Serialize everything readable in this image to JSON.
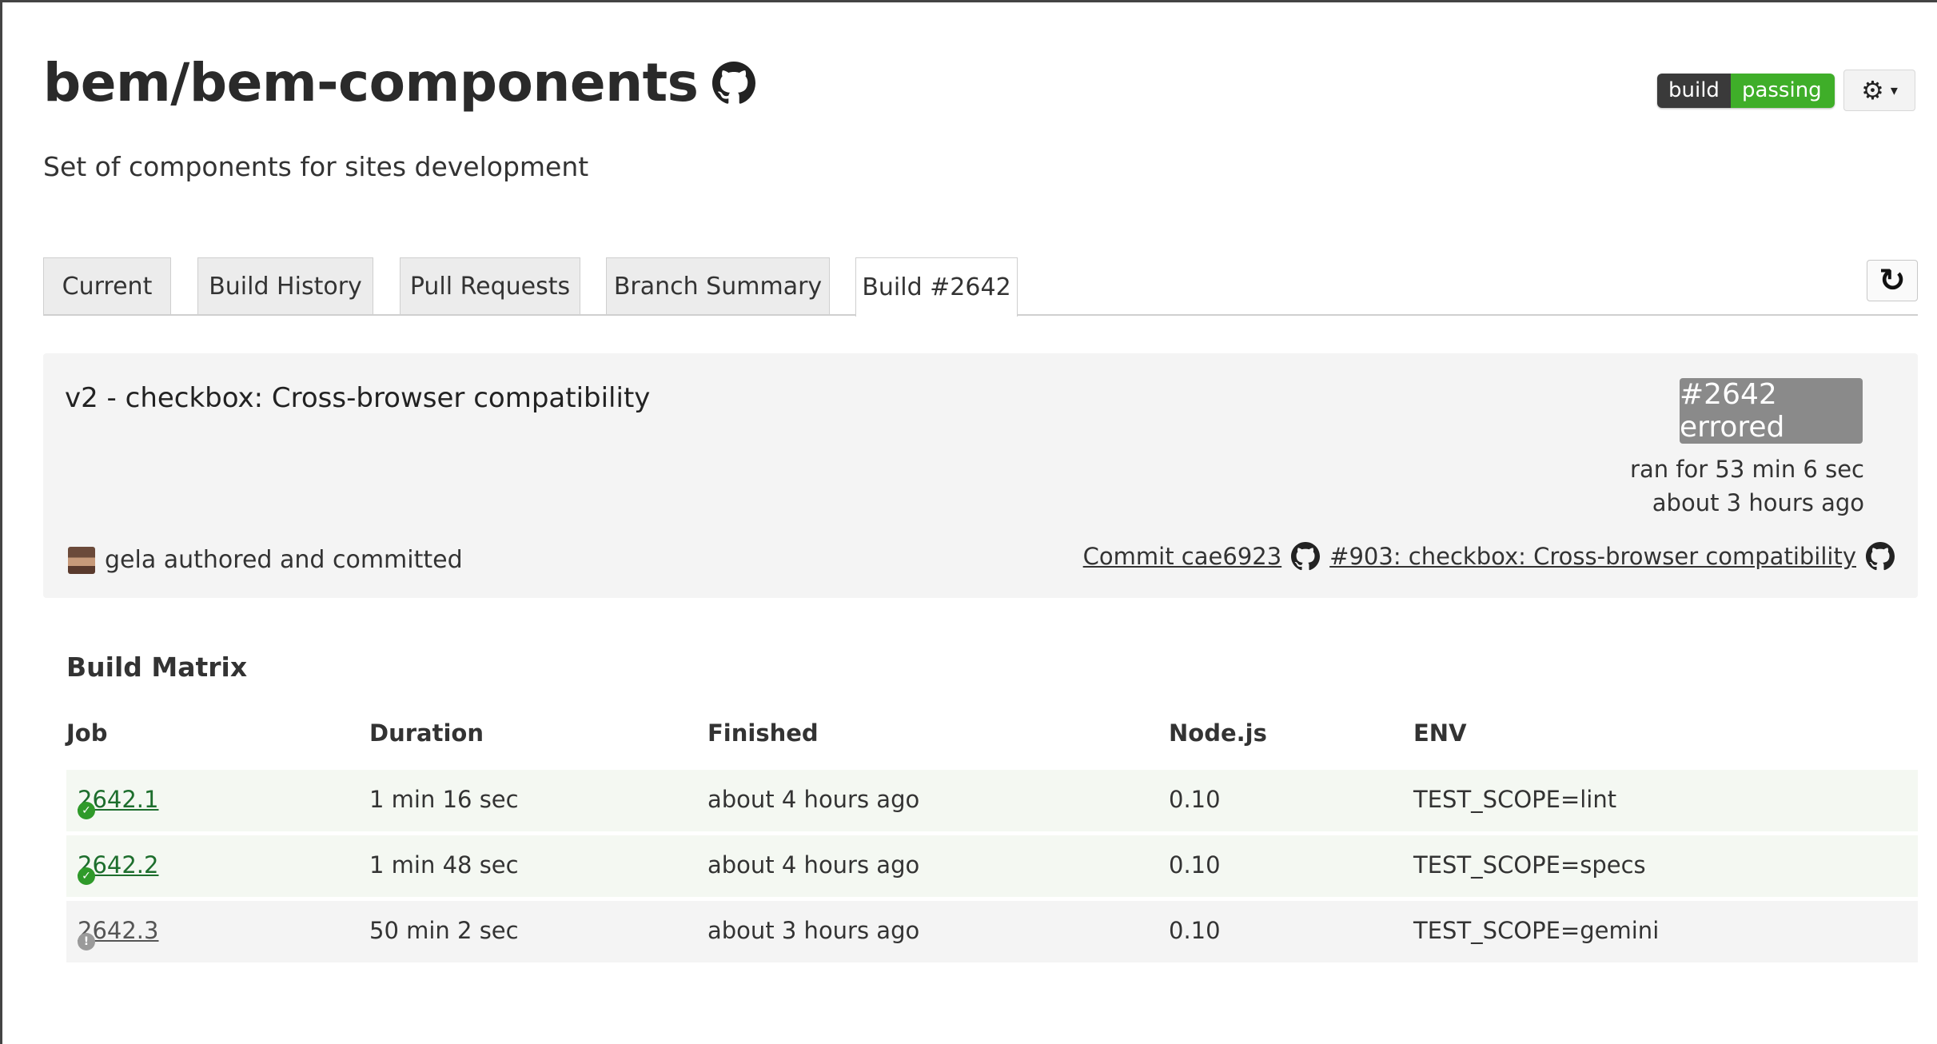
{
  "header": {
    "repo": "bem/bem-components",
    "description": "Set of components for sites development",
    "badge_left": "build",
    "badge_right": "passing",
    "gear_caret": "▾"
  },
  "tabs": [
    {
      "label": "Current"
    },
    {
      "label": "Build History"
    },
    {
      "label": "Pull Requests"
    },
    {
      "label": "Branch Summary"
    },
    {
      "label": "Build #2642",
      "active": true
    }
  ],
  "build": {
    "commit_message": "v2 - checkbox: Cross-browser compatibility",
    "status": "#2642 errored",
    "ran_for": "ran for 53 min 6 sec",
    "finished_ago": "about 3 hours ago",
    "author": "gela authored and committed",
    "commit_link": "Commit cae6923",
    "pr_link": "#903: checkbox: Cross-browser compatibility"
  },
  "matrix": {
    "title": "Build Matrix",
    "columns": {
      "job": "Job",
      "duration": "Duration",
      "finished": "Finished",
      "node": "Node.js",
      "env": "ENV"
    },
    "rows": [
      {
        "state": "passed",
        "job": "2642.1",
        "duration": "1 min 16 sec",
        "finished": "about 4 hours ago",
        "node": "0.10",
        "env": "TEST_SCOPE=lint"
      },
      {
        "state": "passed",
        "job": "2642.2",
        "duration": "1 min 48 sec",
        "finished": "about 4 hours ago",
        "node": "0.10",
        "env": "TEST_SCOPE=specs"
      },
      {
        "state": "errored",
        "job": "2642.3",
        "duration": "50 min 2 sec",
        "finished": "about 3 hours ago",
        "node": "0.10",
        "env": "TEST_SCOPE=gemini"
      }
    ]
  },
  "icons": {
    "github": "github-icon",
    "gear": "gear-icon",
    "refresh": "refresh-icon",
    "passed": "check-circle-icon",
    "errored": "error-circle-icon"
  },
  "colors": {
    "passing": "#3fae29",
    "errored": "#8a8a8a",
    "job_link": "#1d6e2d"
  }
}
